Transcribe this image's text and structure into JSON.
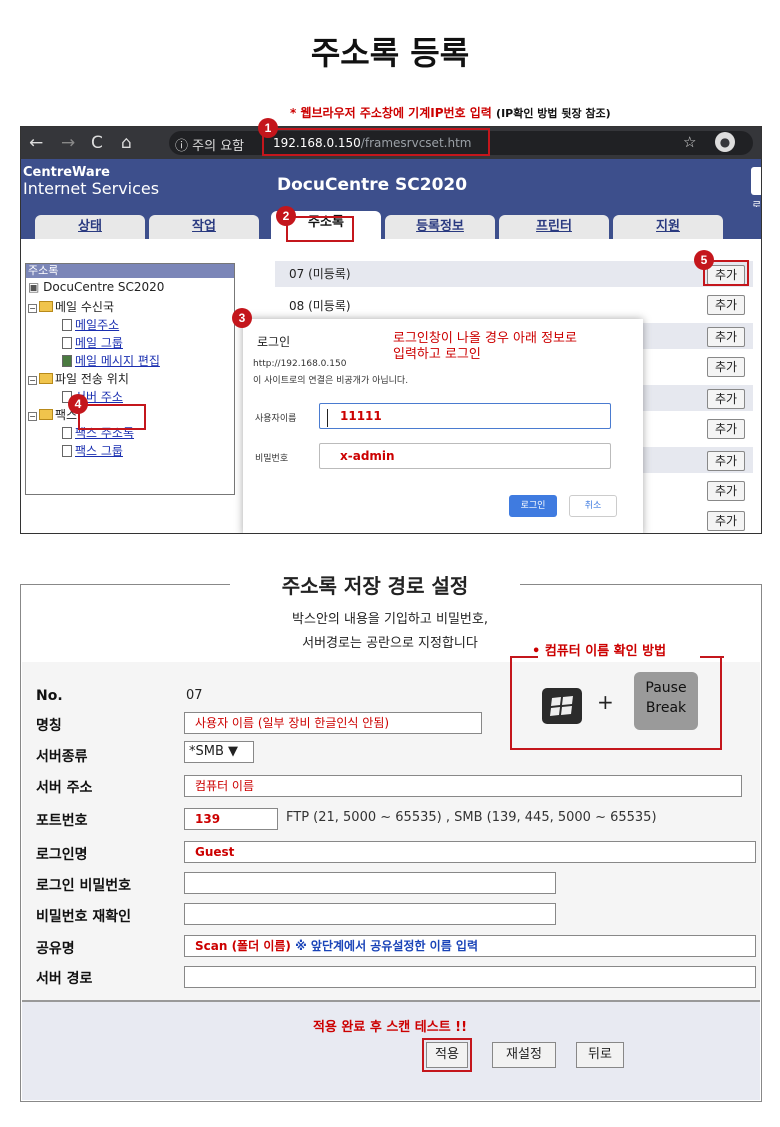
{
  "page_title": "주소록 등록",
  "note_ip": "* 웹브라우저 주소창에 기계IP번호 입력",
  "note_ip_sub": "(IP확인 방법 뒷장 참조)",
  "browser": {
    "secure_label": "주의 요함",
    "url_host": "192.168.0.150",
    "url_path": "/framesrvcset.htm"
  },
  "app": {
    "brand_line1": "CentreWare",
    "brand_line2": "Internet Services",
    "product": "DocuCentre SC2020",
    "edge_text": "로",
    "tabs": [
      "상태",
      "작업",
      "주소록",
      "등록정보",
      "프린터",
      "지원"
    ]
  },
  "tree": {
    "header": "주소록",
    "root": "DocuCentre SC2020",
    "mail_folder": "메일 수신국",
    "mail_address": "메일주소",
    "mail_group": "메일 그룹",
    "mail_message": "메일 메시지 편집",
    "transfer_folder": "파일 전송 위치",
    "server_address": "서버 주소",
    "fax_folder": "팩스",
    "fax_address": "팩스 주소록",
    "fax_group": "팩스 그룹"
  },
  "list": {
    "row1": "07 (미등록)",
    "row2": "08 (미등록)",
    "add_label": "추가"
  },
  "dialog": {
    "title": "로그인",
    "url": "http://192.168.0.150",
    "warning": "이 사이트로의 연결은 비공개가 아닙니다.",
    "username_label": "사용자이름",
    "username_value": "11111",
    "password_label": "비밀번호",
    "password_value": "x-admin",
    "login_button": "로그인",
    "cancel_button": "취소",
    "note_line1": "로그인창이 나올 경우 아래 정보로",
    "note_line2": "입력하고 로그인"
  },
  "badges": [
    "1",
    "2",
    "3",
    "4",
    "5"
  ],
  "section2": {
    "title": "주소록 저장 경로 설정",
    "sub1": "박스안의 내용을 기입하고 비밀번호,",
    "sub2": "서버경로는 공란으로 지정합니다",
    "pc_title": "• 컴퓨터 이름 확인 방법",
    "plus": "+",
    "pause_line1": "Pause",
    "pause_line2": "Break",
    "labels": {
      "no": "No.",
      "name": "명칭",
      "server_type": "서버종류",
      "server_address": "서버 주소",
      "port": "포트번호",
      "login_name": "로그인명",
      "login_password": "로그인 비밀번호",
      "password_confirm": "비밀번호 재확인",
      "share_name": "공유명",
      "server_path": "서버 경로"
    },
    "values": {
      "no": "07",
      "name": "사용자 이름 (일부 장비 한글인식 안됨)",
      "server_type": "*SMB ▼",
      "server_address": "컴퓨터 이름",
      "port": "139",
      "port_hint": "FTP (21, 5000 ~ 65535) ,  SMB (139, 445, 5000 ~ 65535)",
      "login_name": "Guest",
      "share_name": "Scan (폴더 이름)",
      "share_hint": "※ 앞단계에서 공유설정한 이름 입력"
    },
    "footnote": "적용 완료 후 스캔 테스트 !!",
    "buttons": {
      "apply": "적용",
      "reset": "재설정",
      "back": "뒤로"
    }
  },
  "colors": {
    "accent_red": "#c4161c",
    "header_blue": "#3d4f8c",
    "link_blue": "#1a2fb0"
  }
}
